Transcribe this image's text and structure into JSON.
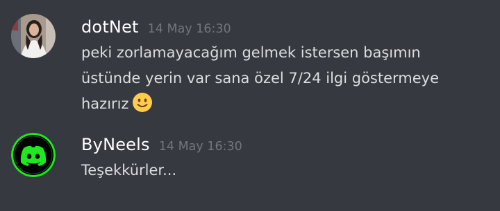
{
  "messages": [
    {
      "username": "dotNet",
      "timestamp": "14 May 16:30",
      "avatar_icon": "user-photo-avatar",
      "lines": [
        "peki zorlamayacağım gelmek istersen başımın",
        "üstünde yerin var sana özel 7/24 ilgi göstermeye",
        "hazırız"
      ],
      "emoji": "slightly-smiling-face-emoji"
    },
    {
      "username": "ByNeels",
      "timestamp": "14 May 16:30",
      "avatar_icon": "discord-logo-avatar",
      "avatar_colors": {
        "background": "#000000",
        "ring": "#1ee81e",
        "logo": "#1ee81e"
      },
      "lines": [
        "Teşekkürler..."
      ]
    }
  ],
  "colors": {
    "background": "#36393f",
    "username": "#ffffff",
    "timestamp": "#72767d",
    "text": "#dcddde"
  }
}
